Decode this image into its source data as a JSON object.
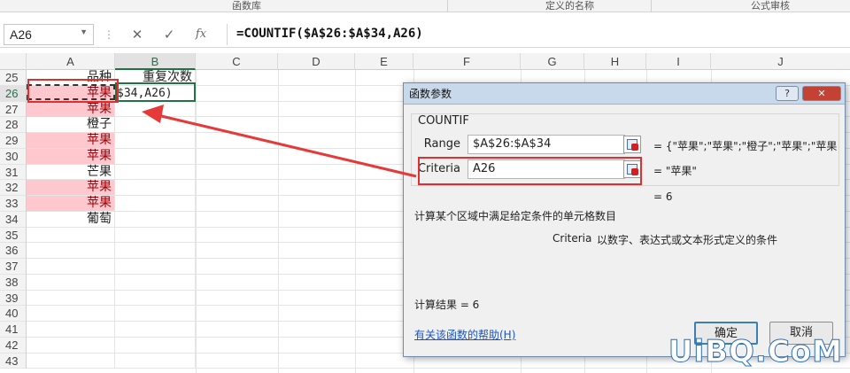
{
  "ribbon": {
    "groups": [
      "函数库",
      "定义的名称",
      "公式审核"
    ]
  },
  "formula_bar": {
    "name_box": "A26",
    "cancel_icon": "✕",
    "enter_icon": "✓",
    "fx_icon": "fx",
    "formula": "=COUNTIF($A$26:$A$34,A26)"
  },
  "columns": [
    "A",
    "B",
    "C",
    "D",
    "E",
    "F",
    "G",
    "H",
    "I",
    "J"
  ],
  "rows": [
    {
      "num": "25",
      "a": "品种",
      "b": "重复次数",
      "pink": false
    },
    {
      "num": "26",
      "a": "苹果",
      "b": "$34,A26)",
      "pink": true
    },
    {
      "num": "27",
      "a": "苹果",
      "b": "",
      "pink": true
    },
    {
      "num": "28",
      "a": "橙子",
      "b": "",
      "pink": false
    },
    {
      "num": "29",
      "a": "苹果",
      "b": "",
      "pink": true
    },
    {
      "num": "30",
      "a": "苹果",
      "b": "",
      "pink": true
    },
    {
      "num": "31",
      "a": "芒果",
      "b": "",
      "pink": false
    },
    {
      "num": "32",
      "a": "苹果",
      "b": "",
      "pink": true
    },
    {
      "num": "33",
      "a": "苹果",
      "b": "",
      "pink": true
    },
    {
      "num": "34",
      "a": "葡萄",
      "b": "",
      "pink": false
    },
    {
      "num": "35",
      "a": "",
      "b": "",
      "pink": false
    },
    {
      "num": "36",
      "a": "",
      "b": "",
      "pink": false
    },
    {
      "num": "37",
      "a": "",
      "b": "",
      "pink": false
    },
    {
      "num": "38",
      "a": "",
      "b": "",
      "pink": false
    },
    {
      "num": "39",
      "a": "",
      "b": "",
      "pink": false
    },
    {
      "num": "40",
      "a": "",
      "b": "",
      "pink": false
    },
    {
      "num": "41",
      "a": "",
      "b": "",
      "pink": false
    },
    {
      "num": "42",
      "a": "",
      "b": "",
      "pink": false
    },
    {
      "num": "43",
      "a": "",
      "b": "",
      "pink": false
    }
  ],
  "dialog": {
    "title": "函数参数",
    "help_btn": "?",
    "close_btn": "✕",
    "function_name": "COUNTIF",
    "range_label": "Range",
    "range_value": "$A$26:$A$34",
    "range_result": "= {\"苹果\";\"苹果\";\"橙子\";\"苹果\";\"苹果",
    "criteria_label": "Criteria",
    "criteria_value": "A26",
    "criteria_result": "= \"苹果\"",
    "formula_result": "= 6",
    "description": "计算某个区域中满足给定条件的单元格数目",
    "arg_name": "Criteria",
    "arg_description": "以数字、表达式或文本形式定义的条件",
    "calc_result": "计算结果 =  6",
    "help_link": "有关该函数的帮助(H)",
    "ok": "确定",
    "cancel": "取消"
  },
  "watermark": "UiBQ.CoM",
  "colors": {
    "pink_fill": "#ffc7ce",
    "pink_text": "#9c0006",
    "selection": "#217346",
    "annotation_red": "#e02f2f"
  }
}
